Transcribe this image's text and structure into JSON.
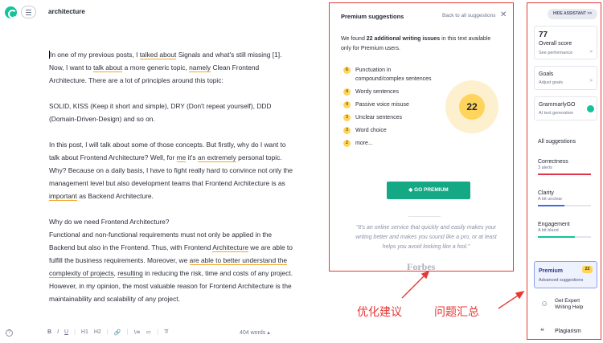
{
  "app": {
    "doc_title": "architecture"
  },
  "editor": {
    "p1_a": "In one of my previous posts, I ",
    "p1_u1": "talked about",
    "p1_b": " Signals and what's still missing [1]. Now, I want to ",
    "p1_u2": "talk about",
    "p1_c": " a more generic topic, ",
    "p1_u3": "namely",
    "p1_d": " Clean Frontend Architecture. There are a lot of principles around this topic:",
    "p2": "SOLID, KISS (Keep it short and simple), DRY (Don't repeat yourself), DDD (Domain-Driven-Design) and so on.",
    "p3_a": "In this post, I will talk about some of those concepts. But firstly, why do I want to talk about Frontend Architecture? Well, for ",
    "p3_u1": "me",
    "p3_b": " it's ",
    "p3_u2": "an extremely",
    "p3_c": " personal topic. Why? Because on a daily basis, I have to fight really hard to convince not only the management level but also development teams that Frontend Architecture is as ",
    "p3_u3": "important",
    "p3_d": " as Backend Architecture.",
    "p4_heading": "Why do we need Frontend Architecture?",
    "p5_a": "Functional and non-functional requirements must not only be applied in the Backend but also in the Frontend. Thus, with Frontend ",
    "p5_u1": "Architecture",
    "p5_b": " we are able to fulfill the business requirements. Moreover, we ",
    "p5_u2": "are able to better understand the complexity of projects",
    "p5_c": ", ",
    "p5_u3": "resulting",
    "p5_d": " in reducing the risk, time and costs of any project. However, in my opinion, the most valuable reason for Frontend Architecture is the maintainability and scalability of any project."
  },
  "format_bar": {
    "help": "?",
    "bold": "B",
    "italic": "I",
    "underline": "U",
    "h1": "H1",
    "h2": "H2",
    "link": "🔗",
    "ordered_list": "⅟≡",
    "bullet_list": "≔",
    "clear_format": "T̸",
    "word_count": "404 words ▴"
  },
  "premium_panel": {
    "title": "Premium suggestions",
    "back_link": "Back to all suggestions",
    "close": "✕",
    "found_prefix": "We found ",
    "found_count": "22 additional writing issues",
    "found_suffix": " in this text available only for Premium users.",
    "issues": [
      {
        "count": "6",
        "label": "Punctuation in compound/complex sentences"
      },
      {
        "count": "4",
        "label": "Wordy sentences"
      },
      {
        "count": "4",
        "label": "Passive voice misuse"
      },
      {
        "count": "3",
        "label": "Unclear sentences"
      },
      {
        "count": "3",
        "label": "Word choice"
      },
      {
        "count": "2",
        "label": "more..."
      }
    ],
    "score_total": "22",
    "cta": "GO PREMIUM",
    "quote": "\"It's an online service that quickly and easily makes your writing better and makes you sound like a pro, or at least helps you avoid looking like a fool.\"",
    "quote_source": "Forbes"
  },
  "annotations": {
    "left": "优化建议",
    "right": "问题汇总",
    "color": "#e53935"
  },
  "assistant": {
    "hide_button": "HIDE ASSISTANT >>",
    "overall_score": {
      "value": "77",
      "title": "Overall score",
      "subtitle": "See performance"
    },
    "goals": {
      "title": "Goals",
      "subtitle": "Adjust goals"
    },
    "grammarly_go": {
      "title": "GrammarlyGO",
      "subtitle": "AI text generation"
    },
    "all_suggestions": "All suggestions",
    "categories": [
      {
        "title": "Correctness",
        "subtitle": "3 alerts",
        "color": "#e0344b",
        "level": 1.0
      },
      {
        "title": "Clarity",
        "subtitle": "A bit unclear",
        "color": "#3d6de0",
        "level": 0.5
      },
      {
        "title": "Engagement",
        "subtitle": "A bit bland",
        "color": "#15c39a",
        "level": 0.7
      }
    ],
    "premium": {
      "title": "Premium",
      "subtitle": "Advanced suggestions",
      "badge": "22"
    },
    "expert": {
      "title": "Get Expert Writing Help"
    },
    "plagiarism": {
      "title": "Plagiarism"
    }
  },
  "colors": {
    "brand_green": "#15c39a",
    "premium_yellow": "#ffd45c",
    "underline_orange": "#f5a623",
    "highlight_red": "#e53935"
  }
}
